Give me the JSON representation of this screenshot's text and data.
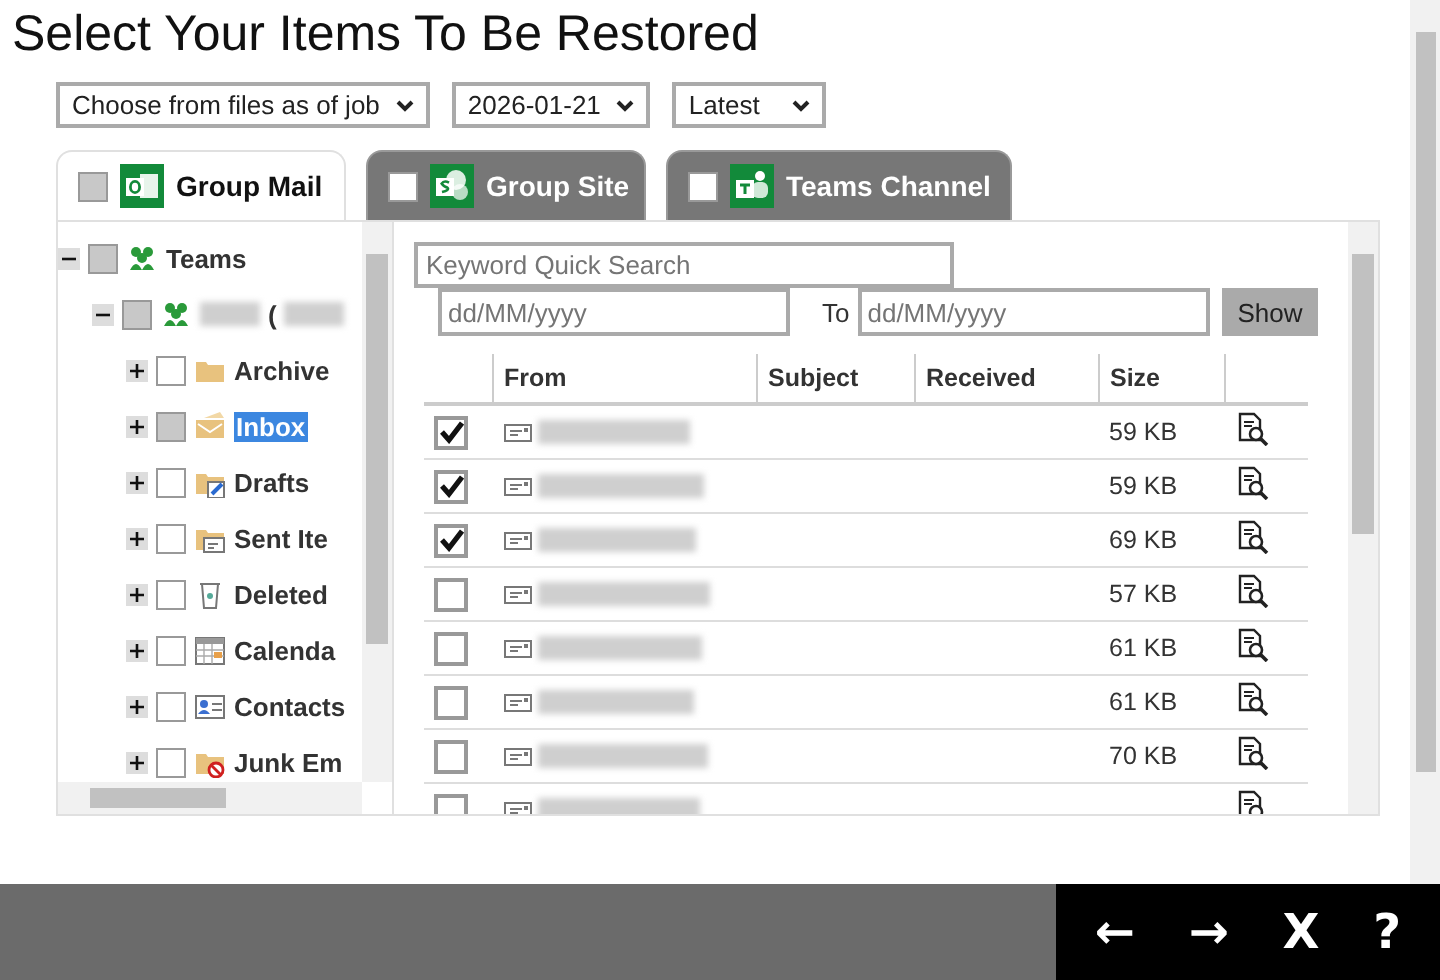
{
  "title": "Select Your Items To Be Restored",
  "filters": [
    {
      "value": "Choose from files as of job"
    },
    {
      "value": "2026-01-21"
    },
    {
      "value": "Latest"
    }
  ],
  "tabs": [
    {
      "label": "Group Mail",
      "selected": true,
      "partial": true,
      "kind": "mail"
    },
    {
      "label": "Group Site",
      "selected": false,
      "partial": false,
      "kind": "site"
    },
    {
      "label": "Teams Channel",
      "selected": false,
      "partial": false,
      "kind": "teams"
    }
  ],
  "tree": [
    {
      "label": "Teams",
      "kind": "group",
      "expanded": true,
      "partial": true,
      "selected": false,
      "children": [
        {
          "label": "(",
          "kind": "group",
          "redacted": true,
          "expanded": true,
          "partial": true,
          "selected": false,
          "children": [
            {
              "label": "Archive",
              "kind": "folder",
              "expanded": false,
              "partial": false,
              "selected": false
            },
            {
              "label": "Inbox",
              "kind": "inbox",
              "expanded": false,
              "partial": true,
              "selected": true
            },
            {
              "label": "Drafts",
              "kind": "drafts",
              "expanded": false,
              "partial": false,
              "selected": false
            },
            {
              "label": "Sent Ite",
              "kind": "sent",
              "expanded": false,
              "partial": false,
              "selected": false
            },
            {
              "label": "Deleted",
              "kind": "trash",
              "expanded": false,
              "partial": false,
              "selected": false
            },
            {
              "label": "Calenda",
              "kind": "calendar",
              "expanded": false,
              "partial": false,
              "selected": false
            },
            {
              "label": "Contacts",
              "kind": "contacts",
              "expanded": false,
              "partial": false,
              "selected": false
            },
            {
              "label": "Junk Em",
              "kind": "junk",
              "expanded": false,
              "partial": false,
              "selected": false
            }
          ]
        }
      ]
    }
  ],
  "search": {
    "placeholder": "Keyword Quick Search"
  },
  "date_from": {
    "placeholder": "dd/MM/yyyy"
  },
  "to_label": "To",
  "date_to": {
    "placeholder": "dd/MM/yyyy"
  },
  "show_button": "Show",
  "table": {
    "columns": [
      "From",
      "Subject",
      "Received",
      "Size"
    ],
    "rows": [
      {
        "checked": true,
        "size": "59 KB"
      },
      {
        "checked": true,
        "size": "59 KB"
      },
      {
        "checked": true,
        "size": "69 KB"
      },
      {
        "checked": false,
        "size": "57 KB"
      },
      {
        "checked": false,
        "size": "61 KB"
      },
      {
        "checked": false,
        "size": "61 KB"
      },
      {
        "checked": false,
        "size": "70 KB"
      },
      {
        "checked": false
      }
    ]
  },
  "nav": [
    "←",
    "→",
    "X",
    "?"
  ]
}
